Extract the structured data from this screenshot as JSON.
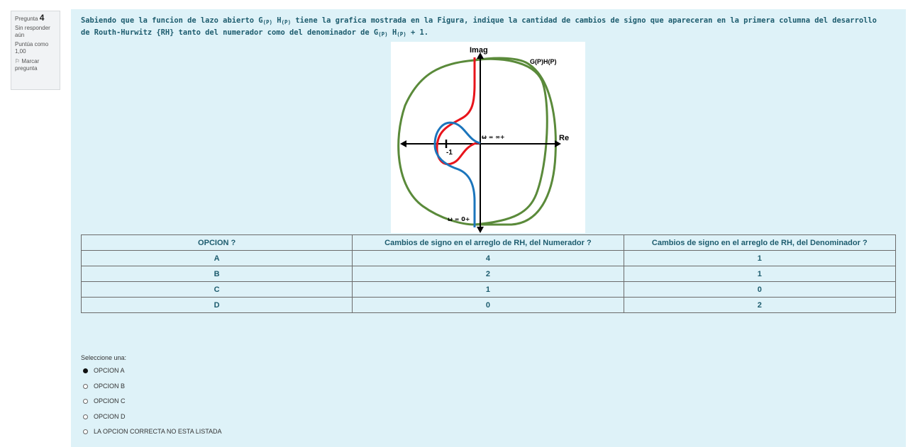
{
  "info": {
    "question_prefix": "Pregunta",
    "question_number": "4",
    "status": "Sin responder aún",
    "score": "Puntúa como 1,00",
    "flag_label": "Marcar pregunta"
  },
  "question": {
    "part1": "Sabiendo que la funcion de lazo abierto G",
    "sub1": "(P)",
    "part2": " H",
    "sub2": "(P)",
    "part3": " tiene la grafica mostrada en la Figura, indique la cantidad de cambios de signo que apareceran en la primera columna del desarrollo de Routh-Hurwitz {RH} tanto del numerador como del denominador de G",
    "sub3": "(P)",
    "part4": " H",
    "sub4": "(P)",
    "part5": " + 1."
  },
  "figure": {
    "imag_label": "Imag",
    "re_label": "Re",
    "fn_label": "G(P)H(P)",
    "omega_inf": "ω = ∞+",
    "omega_zero": "ω = 0+",
    "minus_one": "-1",
    "colors": {
      "outer": "#5a8a3a",
      "red": "#e8141b",
      "blue": "#1b75bc",
      "axis": "#000000"
    }
  },
  "table": {
    "headers": [
      "OPCION ?",
      "Cambios de signo en el arreglo de RH,  del Numerador ?",
      "Cambios de signo en el arreglo de RH, del Denominador ?"
    ],
    "rows": [
      [
        "A",
        "4",
        "1"
      ],
      [
        "B",
        "2",
        "1"
      ],
      [
        "C",
        "1",
        "0"
      ],
      [
        "D",
        "0",
        "2"
      ]
    ]
  },
  "answer": {
    "prompt": "Seleccione una:",
    "options": [
      "OPCION A",
      "OPCION B",
      "OPCION C",
      "OPCION D",
      "LA OPCION CORRECTA NO ESTA LISTADA"
    ],
    "selected": "OPCION A"
  }
}
